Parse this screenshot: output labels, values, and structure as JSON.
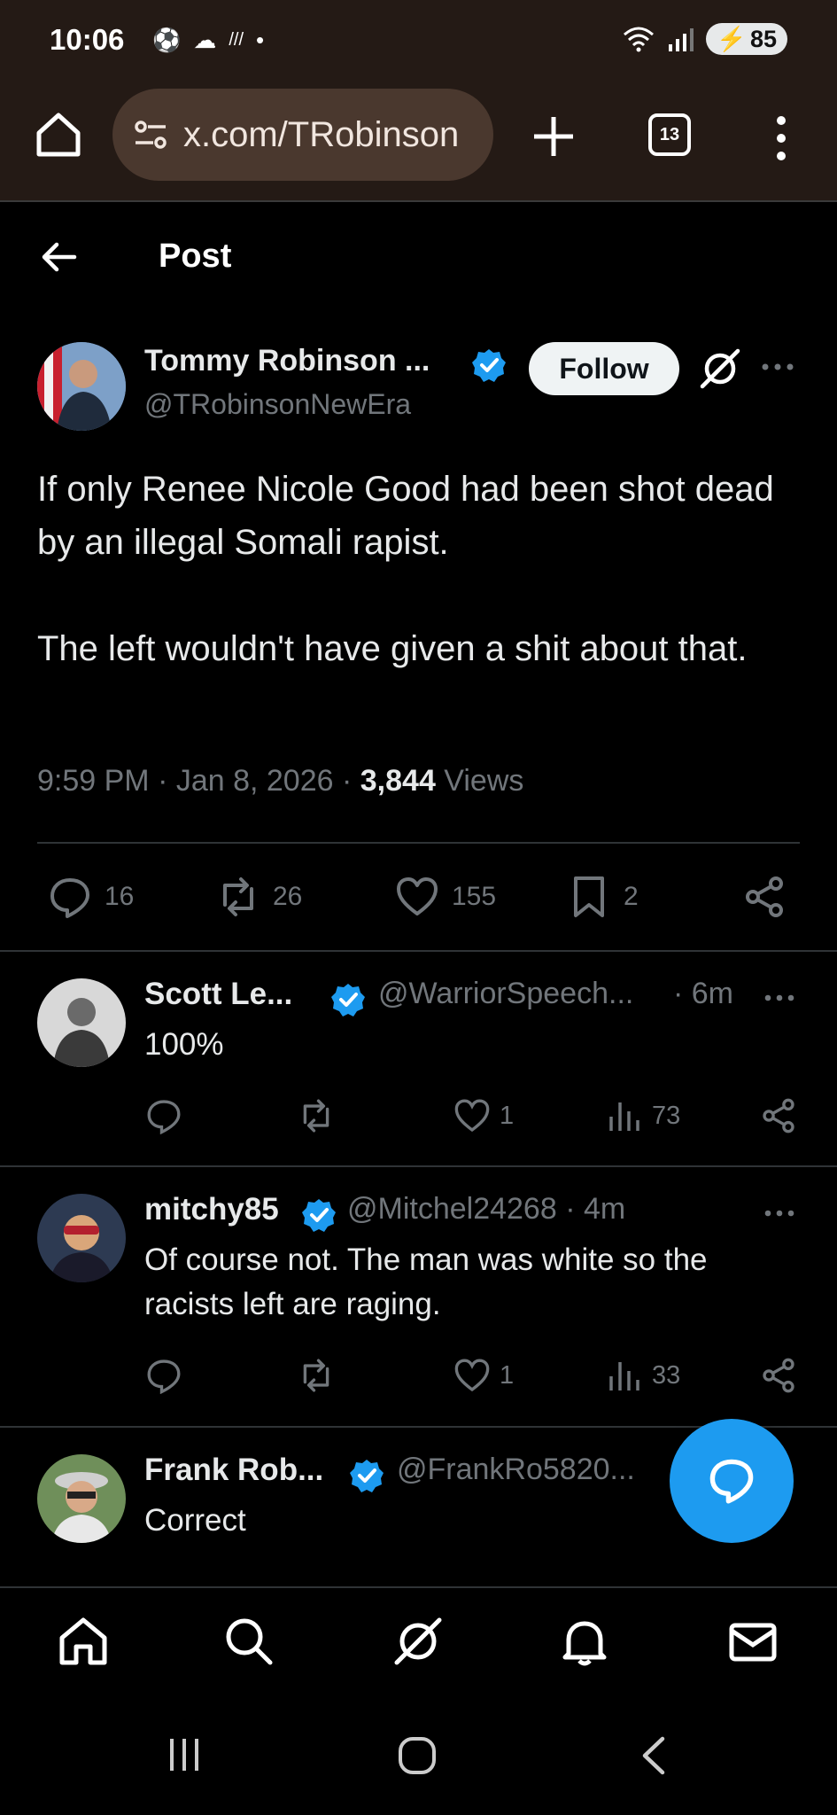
{
  "status_bar": {
    "time": "10:06",
    "battery": "85"
  },
  "browser": {
    "url": "x.com/TRobinson",
    "tab_count": "13"
  },
  "topbar": {
    "title": "Post"
  },
  "post": {
    "author_name": "Tommy Robinson ...",
    "author_handle": "@TRobinsonNewEra",
    "follow_label": "Follow",
    "text": "If only Renee Nicole Good had been shot dead by an illegal Somali rapist.\n\nThe left wouldn't have given a shit about that.",
    "time": "9:59 PM · Jan 8, 2026 · ",
    "views_count": "3,844",
    "views_label": " Views",
    "replies": "16",
    "reposts": "26",
    "likes": "155",
    "bookmarks": "2"
  },
  "replies": [
    {
      "name": "Scott Le...",
      "handle": "@WarriorSpeech...",
      "time": "· 6m",
      "text": "100%",
      "likes": "1",
      "views": "73"
    },
    {
      "name": "mitchy85",
      "handle": "@Mitchel24268 · 4m",
      "time": "",
      "text": "Of course not. The man was white so the racists left are raging.",
      "likes": "1",
      "views": "33"
    },
    {
      "name": "Frank Rob...",
      "handle": "@FrankRo5820...",
      "time": "",
      "text": "Correct",
      "likes": "",
      "views": ""
    }
  ],
  "colors": {
    "accent": "#1d9bf0",
    "browser_bar": "#241a15",
    "url_pill": "#4a382e"
  }
}
